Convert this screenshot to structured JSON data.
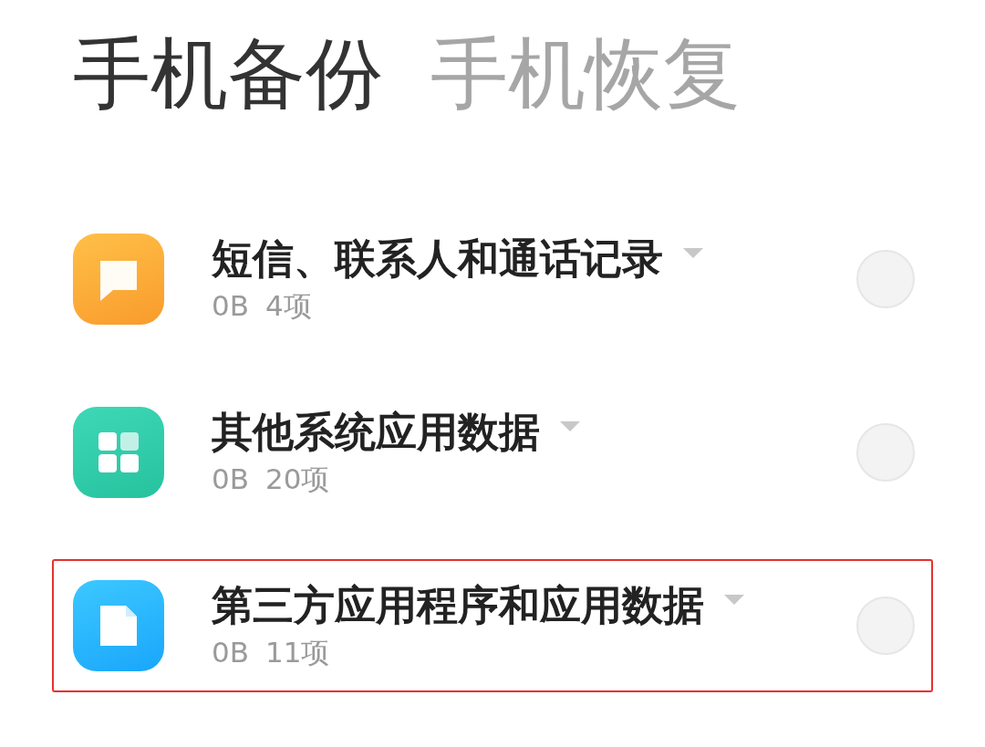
{
  "tabs": [
    {
      "label": "手机备份",
      "selected": true
    },
    {
      "label": "手机恢复",
      "selected": false
    }
  ],
  "items": [
    {
      "kind": "message",
      "title": "短信、联系人和通话记录",
      "size": "0B",
      "count": "4项",
      "checked": false,
      "highlighted": false
    },
    {
      "kind": "apps",
      "title": "其他系统应用数据",
      "size": "0B",
      "count": "20项",
      "checked": false,
      "highlighted": false
    },
    {
      "kind": "file",
      "title": "第三方应用程序和应用数据",
      "size": "0B",
      "count": "11项",
      "checked": false,
      "highlighted": true
    }
  ]
}
